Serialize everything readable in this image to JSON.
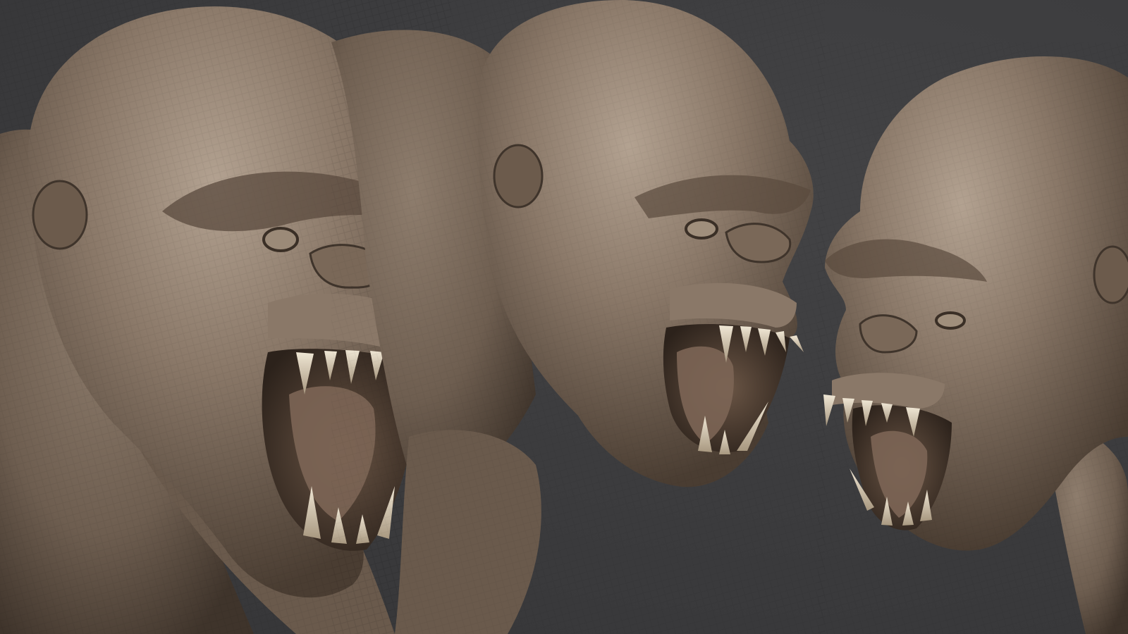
{
  "scene": {
    "background_color": "#3b3b3d",
    "clay_color": "#7a6a5c",
    "clay_highlight": "#b3a291",
    "clay_shadow": "#3f342b",
    "mouth_color": "#4a3a30",
    "tooth_color": "#e6dcc8",
    "busts": [
      {
        "name": "left-bust",
        "view": "three-quarter-right"
      },
      {
        "name": "center-bust",
        "view": "profile-right"
      },
      {
        "name": "right-bust",
        "view": "three-quarter-left"
      }
    ]
  }
}
